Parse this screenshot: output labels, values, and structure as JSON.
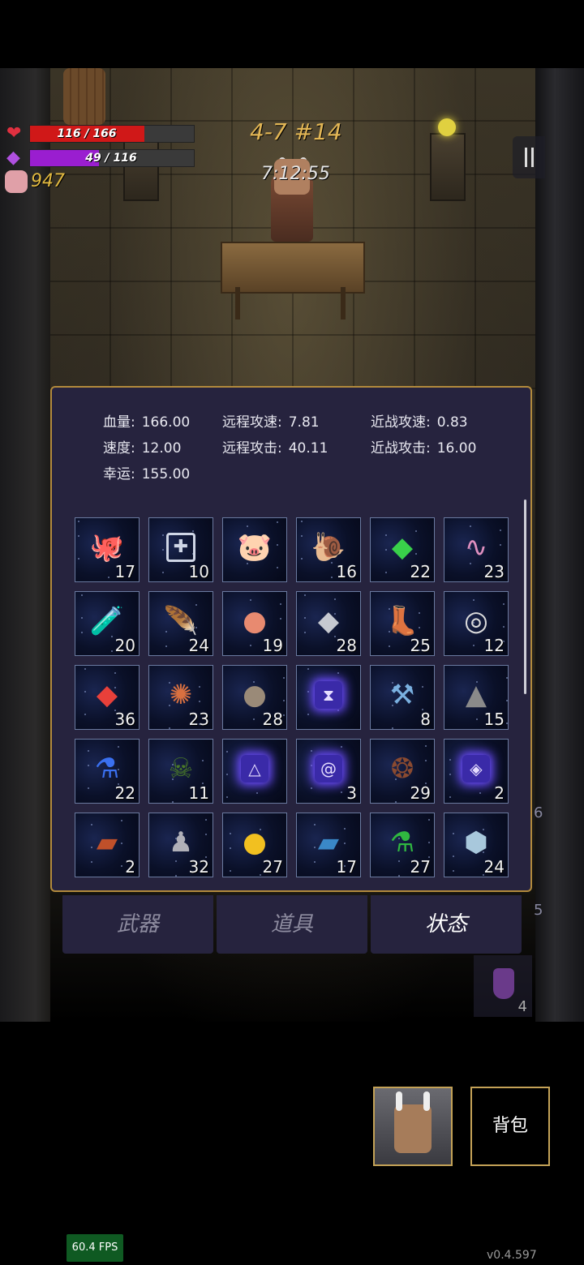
{
  "hud": {
    "hp_text": "116 / 166",
    "hp_fraction": 0.699,
    "mp_text": "49 / 116",
    "mp_fraction": 0.422,
    "gold": "947",
    "level": "4-7 #14",
    "timer": "7:12:55"
  },
  "stats": [
    {
      "label": "血量:",
      "value": "166.00"
    },
    {
      "label": "远程攻速:",
      "value": "7.81"
    },
    {
      "label": "近战攻速:",
      "value": "0.83"
    },
    {
      "label": "速度:",
      "value": "12.00"
    },
    {
      "label": "远程攻击:",
      "value": "40.11"
    },
    {
      "label": "近战攻击:",
      "value": "16.00"
    },
    {
      "label": "幸运:",
      "value": "155.00"
    }
  ],
  "items": [
    {
      "icon": "tentacle-icon",
      "count": "17"
    },
    {
      "icon": "medkit-icon",
      "count": "10"
    },
    {
      "icon": "piggy-bank-icon",
      "count": ""
    },
    {
      "icon": "purple-snail-icon",
      "count": "16"
    },
    {
      "icon": "green-crystal-icon",
      "count": "22"
    },
    {
      "icon": "pink-worm-icon",
      "count": "23"
    },
    {
      "icon": "vial-icon",
      "count": "20"
    },
    {
      "icon": "feather-icon",
      "count": "24"
    },
    {
      "icon": "peach-icon",
      "count": "19"
    },
    {
      "icon": "silver-ore-icon",
      "count": "28"
    },
    {
      "icon": "boots-icon",
      "count": "25"
    },
    {
      "icon": "rings-icon",
      "count": "12"
    },
    {
      "icon": "red-crystal-icon",
      "count": "36"
    },
    {
      "icon": "spiky-mask-icon",
      "count": "23"
    },
    {
      "icon": "rocks-icon",
      "count": "28"
    },
    {
      "icon": "hourglass-rune-icon",
      "count": ""
    },
    {
      "icon": "hammer-icon",
      "count": "8"
    },
    {
      "icon": "tombstone-icon",
      "count": "15"
    },
    {
      "icon": "blue-potion-icon",
      "count": "22"
    },
    {
      "icon": "skull-book-icon",
      "count": "11"
    },
    {
      "icon": "triangle-rune-icon",
      "count": ""
    },
    {
      "icon": "spiral-rune-icon",
      "count": "3"
    },
    {
      "icon": "thorn-wreath-icon",
      "count": "29"
    },
    {
      "icon": "eye-rune-icon",
      "count": "2"
    },
    {
      "icon": "red-tome-icon",
      "count": "2"
    },
    {
      "icon": "ghost-cloak-icon",
      "count": "32"
    },
    {
      "icon": "gold-coin-icon",
      "count": "27"
    },
    {
      "icon": "blue-tome-icon",
      "count": "17"
    },
    {
      "icon": "green-potion-icon",
      "count": "27"
    },
    {
      "icon": "ice-ore-icon",
      "count": "24"
    }
  ],
  "tabs": [
    {
      "label": "武器",
      "active": false
    },
    {
      "label": "道具",
      "active": false
    },
    {
      "label": "状态",
      "active": true
    }
  ],
  "side_counts": {
    "a": "6",
    "b": "5",
    "c": "4"
  },
  "bag_label": "背包",
  "fps": "60.4 FPS",
  "version": "v0.4.597",
  "colors": {
    "hp": "#d01818",
    "mp": "#9a1ed0",
    "panel_border": "#b28a3c",
    "panel_bg": "#26233e"
  }
}
